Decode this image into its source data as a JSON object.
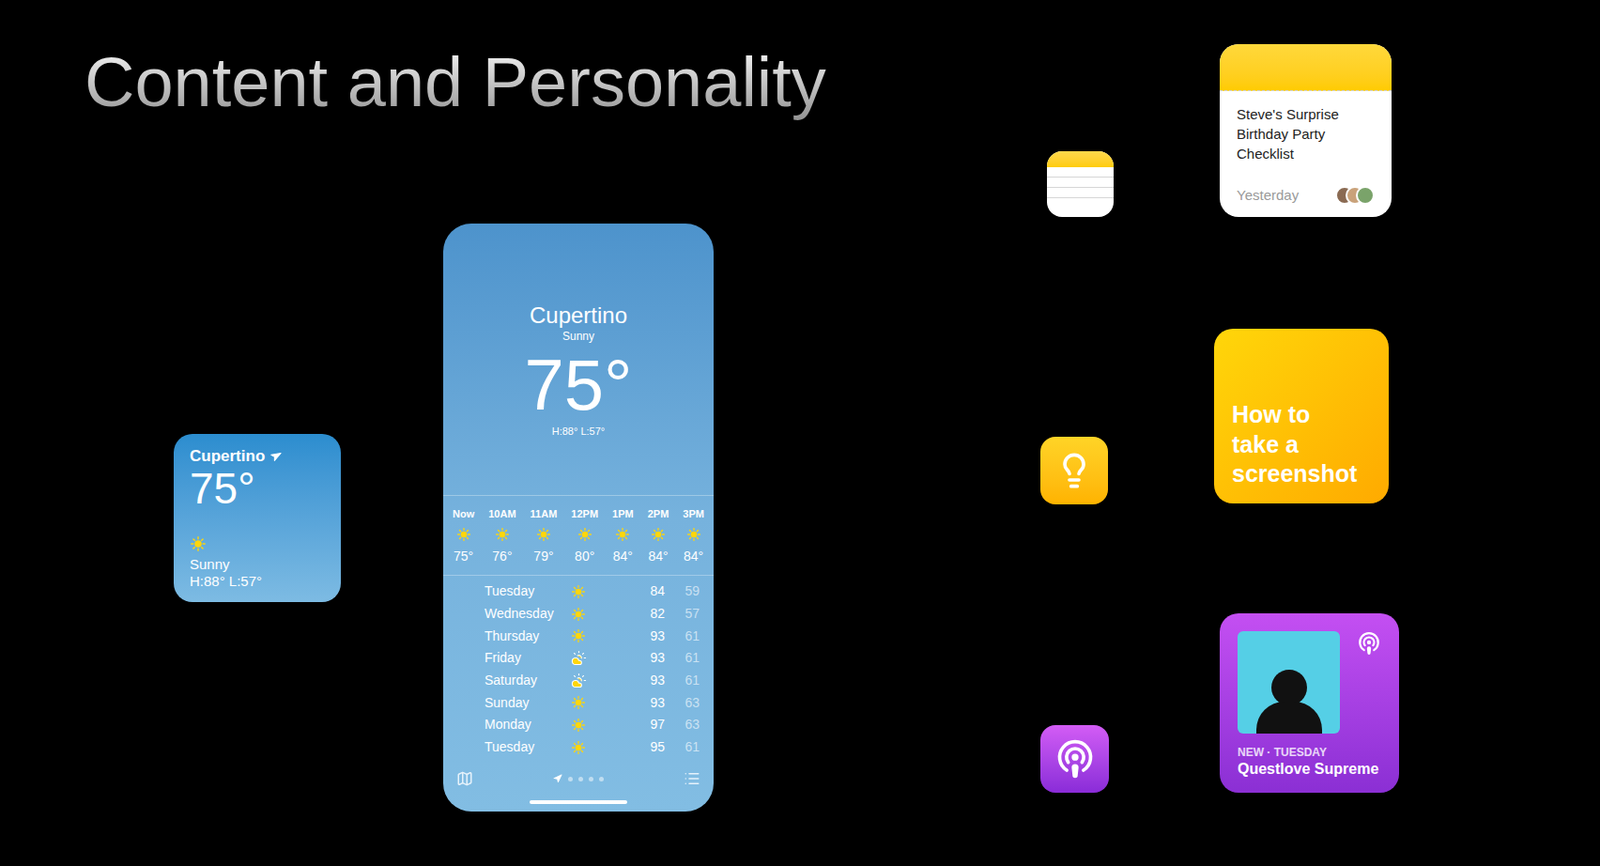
{
  "slide": {
    "title": "Content and Personality"
  },
  "weather_widget": {
    "city": "Cupertino",
    "temperature": "75°",
    "condition": "Sunny",
    "high_low": "H:88° L:57°"
  },
  "weather_app": {
    "city": "Cupertino",
    "condition": "Sunny",
    "temperature": "75°",
    "high_low": "H:88° L:57°",
    "hourly": [
      {
        "time": "Now",
        "temp": "75°"
      },
      {
        "time": "10AM",
        "temp": "76°"
      },
      {
        "time": "11AM",
        "temp": "79°"
      },
      {
        "time": "12PM",
        "temp": "80°"
      },
      {
        "time": "1PM",
        "temp": "84°"
      },
      {
        "time": "2PM",
        "temp": "84°"
      },
      {
        "time": "3PM",
        "temp": "84°"
      }
    ],
    "daily": [
      {
        "day": "Tuesday",
        "kind": "sunny",
        "high": "84",
        "low": "59"
      },
      {
        "day": "Wednesday",
        "kind": "sunny",
        "high": "82",
        "low": "57"
      },
      {
        "day": "Thursday",
        "kind": "sunny",
        "high": "93",
        "low": "61"
      },
      {
        "day": "Friday",
        "kind": "partly-cloudy",
        "high": "93",
        "low": "61"
      },
      {
        "day": "Saturday",
        "kind": "partly-cloudy",
        "high": "93",
        "low": "61"
      },
      {
        "day": "Sunday",
        "kind": "sunny",
        "high": "93",
        "low": "63"
      },
      {
        "day": "Monday",
        "kind": "sunny",
        "high": "97",
        "low": "63"
      },
      {
        "day": "Tuesday",
        "kind": "sunny",
        "high": "95",
        "low": "61"
      }
    ],
    "pages": [
      {
        "kind": "location",
        "selected": true
      },
      {
        "kind": "dot",
        "selected": false
      },
      {
        "kind": "dot",
        "selected": false
      },
      {
        "kind": "dot",
        "selected": false
      },
      {
        "kind": "dot",
        "selected": false
      }
    ]
  },
  "notes_widget": {
    "title": "Steve's Surprise Birthday Party Checklist",
    "date": "Yesterday"
  },
  "tips_widget": {
    "title": "How to take a screenshot"
  },
  "podcast_widget": {
    "label": "NEW · TUESDAY",
    "show": "Questlove Supreme"
  }
}
